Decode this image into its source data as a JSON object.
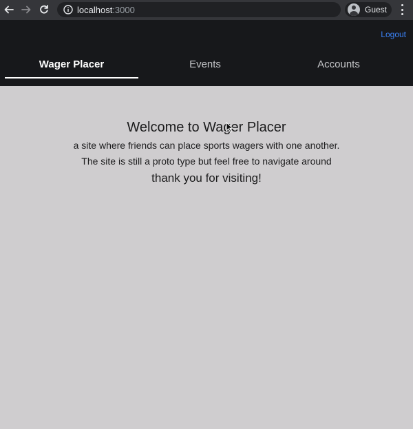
{
  "browser": {
    "url_host": "localhost",
    "url_port": ":3000",
    "profile_name": "Guest",
    "icons": [
      "back-arrow-icon",
      "forward-arrow-icon",
      "reload-icon",
      "info-icon",
      "profile-avatar-icon",
      "more-menu-icon"
    ]
  },
  "header": {
    "logout_label": "Logout",
    "link_color": "#3b82f6",
    "background": "#17181b",
    "tabs": [
      {
        "label": "Wager Placer",
        "active": true
      },
      {
        "label": "Events",
        "active": false
      },
      {
        "label": "Accounts",
        "active": false
      }
    ]
  },
  "main": {
    "title": "Welcome to Wager Placer",
    "line1": "a site where friends can place sports wagers with one another.",
    "line2": "The site is still a proto type but feel free to navigate around",
    "thanks": "thank you for visiting!",
    "background": "#cfcdcf"
  }
}
